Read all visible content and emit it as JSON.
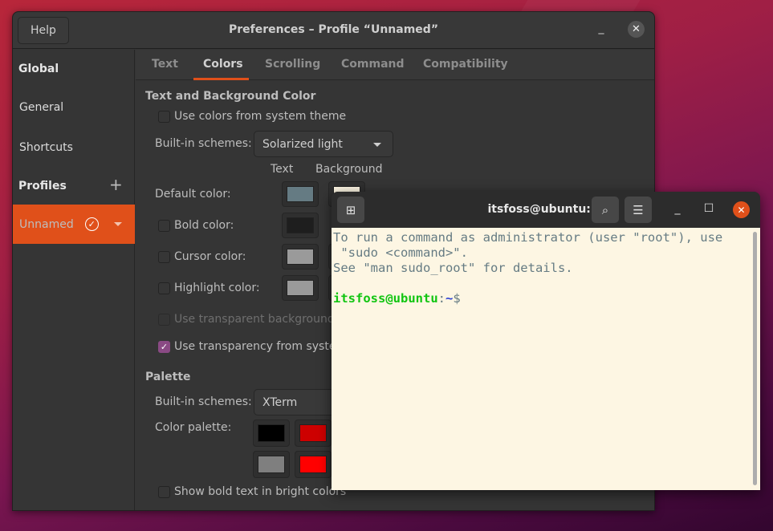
{
  "preferences": {
    "title": "Preferences – Profile “Unnamed”",
    "help_label": "Help",
    "minimize_glyph": "_",
    "close_glyph": "✕",
    "sidebar": {
      "global_heading": "Global",
      "items": [
        {
          "label": "General"
        },
        {
          "label": "Shortcuts"
        }
      ],
      "profiles_heading": "Profiles",
      "add_glyph": "+",
      "selected_profile": "Unnamed",
      "check_glyph": "✓"
    },
    "tabs": [
      {
        "label": "Text",
        "active": false
      },
      {
        "label": "Colors",
        "active": true
      },
      {
        "label": "Scrolling",
        "active": false
      },
      {
        "label": "Command",
        "active": false
      },
      {
        "label": "Compatibility",
        "active": false
      }
    ],
    "text_bg": {
      "heading": "Text and Background Color",
      "use_system_colors": {
        "label": "Use colors from system theme",
        "checked": false
      },
      "builtin_label": "Built-in schemes:",
      "builtin_value": "Solarized light",
      "col_text": "Text",
      "col_background": "Background",
      "rows": [
        {
          "label": "Default color:",
          "text_color": "#657b83",
          "bg_color": "#fdf6e3"
        },
        {
          "label": "Bold color:",
          "checked": false,
          "text_color": "#1e1e1e"
        },
        {
          "label": "Cursor color:",
          "checked": false,
          "text_color": "#9a9a9a",
          "bg_color": "#1e1e1e"
        },
        {
          "label": "Highlight color:",
          "checked": false,
          "text_color": "#9a9a9a",
          "bg_color": "#1e1e1e"
        }
      ],
      "transparent_bg": {
        "label": "Use transparent background",
        "checked": false
      },
      "system_transparency": {
        "label": "Use transparency from system theme",
        "checked": true
      }
    },
    "palette": {
      "heading": "Palette",
      "builtin_label": "Built-in schemes:",
      "builtin_value": "XTerm",
      "palette_label": "Color palette:",
      "colors_row1": [
        "#000000",
        "#cd0000"
      ],
      "colors_row2": [
        "#7f7f7f",
        "#ff0000"
      ],
      "bold_bright": {
        "label": "Show bold text in bright colors",
        "checked": false
      }
    }
  },
  "terminal": {
    "title": "itsfoss@ubuntu: ~",
    "new_tab_glyph": "⊞",
    "search_glyph": "⌕",
    "menu_glyph": "☰",
    "minimize_glyph": "_",
    "maximize_glyph": "☐",
    "close_glyph": "✕",
    "lines": [
      "To run a command as administrator (user \"root\"), use",
      " \"sudo <command>\".",
      "See \"man sudo_root\" for details.",
      ""
    ],
    "prompt_user": "itsfoss@ubuntu",
    "prompt_sep": ":",
    "prompt_path": "~",
    "prompt_symbol": "$"
  }
}
